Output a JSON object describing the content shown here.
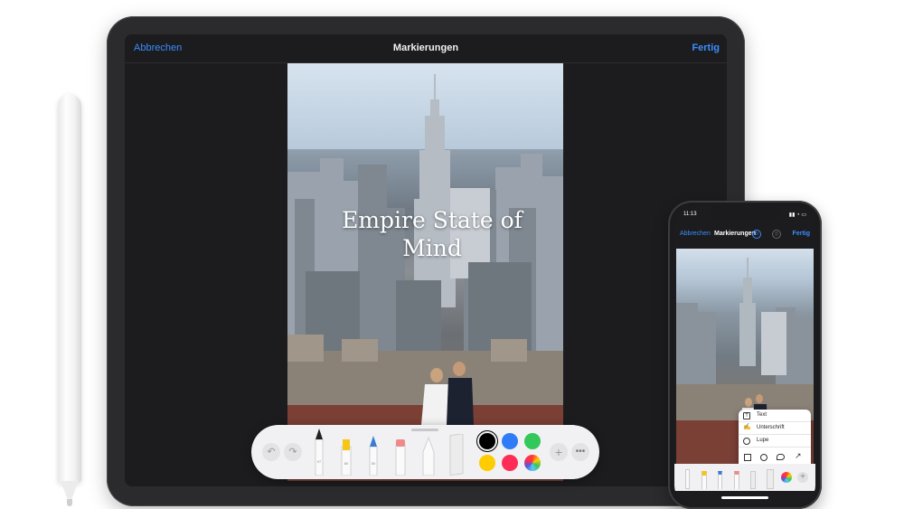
{
  "ipad": {
    "nav": {
      "cancel_label": "Abbrechen",
      "title": "Markierungen",
      "done_label": "Fertig"
    },
    "photo_title": "Empire State of Mind",
    "toolbar": {
      "undo_icon": "undo-icon",
      "redo_icon": "redo-icon",
      "tools": [
        "pen",
        "highlighter",
        "pencil",
        "eraser",
        "lasso",
        "ruler"
      ],
      "tool_numbers": [
        "97",
        "80",
        "50"
      ],
      "colors": [
        "#000000",
        "#2f7cf6",
        "#34c759",
        "#ffcc00",
        "#ff2d55"
      ],
      "add_icon": "plus-icon",
      "more_icon": "ellipsis-icon"
    }
  },
  "iphone": {
    "status": {
      "time": "11:13",
      "icons": "▮▮ ◔ ▭"
    },
    "nav": {
      "cancel_label": "Abbrechen",
      "title": "Markierungen",
      "done_label": "Fertig"
    },
    "menu": {
      "items": [
        {
          "label": "Text",
          "icon": "text-box-icon"
        },
        {
          "label": "Unterschrift",
          "icon": "signature-icon"
        },
        {
          "label": "Lupe",
          "icon": "magnifier-icon"
        }
      ],
      "shapes": [
        "square-icon",
        "circle-icon",
        "speech-bubble-icon",
        "arrow-icon"
      ]
    }
  },
  "colors": {
    "accent": "#3a8dff",
    "screen_bg": "#1c1c1e",
    "toolbar_bg": "#f1f1f3"
  }
}
